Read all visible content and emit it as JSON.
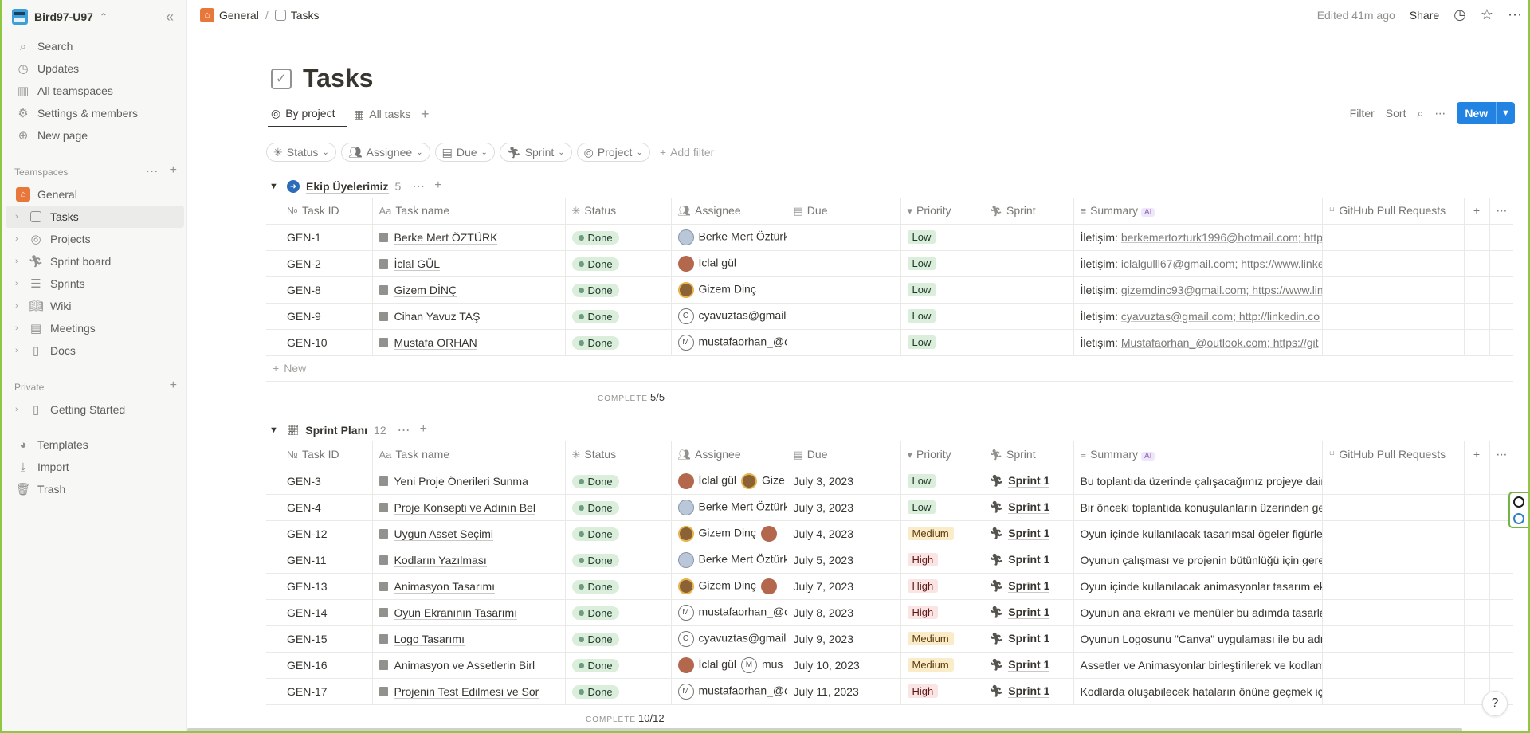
{
  "workspace": {
    "name": "Bird97-U97"
  },
  "sidebar": {
    "top_items": [
      {
        "label": "Search",
        "icon": "search-icon"
      },
      {
        "label": "Updates",
        "icon": "clock-icon"
      },
      {
        "label": "All teamspaces",
        "icon": "building-icon"
      },
      {
        "label": "Settings & members",
        "icon": "gear-icon"
      },
      {
        "label": "New page",
        "icon": "plus-circle-icon"
      }
    ],
    "teamspaces_label": "Teamspaces",
    "teamspace_items": [
      {
        "label": "General",
        "icon": "home-icon"
      },
      {
        "label": "Tasks",
        "icon": "checkbox-icon"
      },
      {
        "label": "Projects",
        "icon": "target-icon"
      },
      {
        "label": "Sprint board",
        "icon": "runner-icon"
      },
      {
        "label": "Sprints",
        "icon": "stack-icon"
      },
      {
        "label": "Wiki",
        "icon": "book-icon"
      },
      {
        "label": "Meetings",
        "icon": "calendar-icon"
      },
      {
        "label": "Docs",
        "icon": "document-icon"
      }
    ],
    "private_label": "Private",
    "private_items": [
      {
        "label": "Getting Started",
        "icon": "document-icon"
      }
    ],
    "bottom_items": [
      {
        "label": "Templates",
        "icon": "shapes-icon"
      },
      {
        "label": "Import",
        "icon": "download-icon"
      },
      {
        "label": "Trash",
        "icon": "trash-icon"
      }
    ]
  },
  "topbar": {
    "breadcrumb": [
      "General",
      "Tasks"
    ],
    "edited": "Edited 41m ago",
    "share": "Share"
  },
  "page": {
    "title": "Tasks",
    "views": [
      {
        "label": "By project"
      },
      {
        "label": "All tasks"
      }
    ],
    "tools": {
      "filter": "Filter",
      "sort": "Sort",
      "new": "New"
    },
    "filters": [
      "Status",
      "Assignee",
      "Due",
      "Sprint",
      "Project"
    ],
    "add_filter": "Add filter"
  },
  "columns": [
    "Task ID",
    "Task name",
    "Status",
    "Assignee",
    "Due",
    "Priority",
    "Sprint",
    "Summary",
    "GitHub Pull Requests"
  ],
  "ai_badge": "AI",
  "groups": [
    {
      "name": "Ekip Üyelerimiz",
      "count": "5",
      "complete_label": "COMPLETE",
      "complete": "5/5",
      "new_label": "New",
      "rows": [
        {
          "id": "GEN-1",
          "name": "Berke Mert ÖZTÜRK",
          "status": "Done",
          "assignee": "Berke Mert Öztürk",
          "avatar": "b",
          "due": "",
          "priority": "Low",
          "sprint": "",
          "summary_prefix": "İletişim: ",
          "summary": "berkemertozturk1996@hotmail.com; http"
        },
        {
          "id": "GEN-2",
          "name": "İclal GÜL",
          "status": "Done",
          "assignee": "İclal gül",
          "avatar": "i",
          "due": "",
          "priority": "Low",
          "sprint": "",
          "summary_prefix": "İletişim: ",
          "summary": "iclalgulll67@gmail.com; https://www.linke"
        },
        {
          "id": "GEN-8",
          "name": "Gizem DİNÇ",
          "status": "Done",
          "assignee": "Gizem Dinç",
          "avatar": "g",
          "due": "",
          "priority": "Low",
          "sprint": "",
          "summary_prefix": "İletişim: ",
          "summary": "gizemdinc93@gmail.com; https://www.lin"
        },
        {
          "id": "GEN-9",
          "name": "Cihan Yavuz TAŞ",
          "status": "Done",
          "assignee": "cyavuztas@gmail.",
          "avatar": "C",
          "due": "",
          "priority": "Low",
          "sprint": "",
          "summary_prefix": "İletişim: ",
          "summary": "cyavuztas@gmail.com; http://linkedin.co"
        },
        {
          "id": "GEN-10",
          "name": "Mustafa ORHAN",
          "status": "Done",
          "assignee": "mustafaorhan_@c",
          "avatar": "M",
          "due": "",
          "priority": "Low",
          "sprint": "",
          "summary_prefix": "İletişim: ",
          "summary": "Mustafaorhan_@outlook.com; https://git"
        }
      ]
    },
    {
      "name": "Sprint Planı",
      "count": "12",
      "complete_label": "COMPLETE",
      "complete": "10/12",
      "rows": [
        {
          "id": "GEN-3",
          "name": "Yeni Proje Önerileri Sunma",
          "status": "Done",
          "assignee": "İclal gül",
          "avatar": "i",
          "assignee2": "Gize",
          "avatar2": "g",
          "due": "July 3, 2023",
          "priority": "Low",
          "sprint": "Sprint 1",
          "summary_prefix": "",
          "summary": "Bu toplantıda üzerinde çalışacağımız projeye dair"
        },
        {
          "id": "GEN-4",
          "name": "Proje Konsepti ve Adının Bel",
          "status": "Done",
          "assignee": "Berke Mert Öztürk",
          "avatar": "b",
          "due": "July 3, 2023",
          "priority": "Low",
          "sprint": "Sprint 1",
          "summary_prefix": "",
          "summary": "Bir önceki toplantıda konuşulanların üzerinden ge"
        },
        {
          "id": "GEN-12",
          "name": "Uygun Asset Seçimi",
          "status": "Done",
          "assignee": "Gizem Dinç",
          "avatar": "g",
          "assignee2": "",
          "avatar2": "i",
          "due": "July 4, 2023",
          "priority": "Medium",
          "sprint": "Sprint 1",
          "summary_prefix": "",
          "summary": "Oyun içinde kullanılacak tasarımsal ögeler figürle"
        },
        {
          "id": "GEN-11",
          "name": "Kodların Yazılması",
          "status": "Done",
          "assignee": "Berke Mert Öztürk",
          "avatar": "b",
          "due": "July 5, 2023",
          "priority": "High",
          "sprint": "Sprint 1",
          "summary_prefix": "",
          "summary": "Oyunun çalışması ve projenin bütünlüğü için gere"
        },
        {
          "id": "GEN-13",
          "name": "Animasyon Tasarımı",
          "status": "Done",
          "assignee": "Gizem Dinç",
          "avatar": "g",
          "assignee2": "",
          "avatar2": "i",
          "due": "July 7, 2023",
          "priority": "High",
          "sprint": "Sprint 1",
          "summary_prefix": "",
          "summary": "Oyun içinde kullanılacak animasyonlar tasarım eki"
        },
        {
          "id": "GEN-14",
          "name": "Oyun Ekranının Tasarımı",
          "status": "Done",
          "assignee": "mustafaorhan_@c",
          "avatar": "M",
          "due": "July 8, 2023",
          "priority": "High",
          "sprint": "Sprint 1",
          "summary_prefix": "",
          "summary": "Oyunun ana ekranı ve menüler bu adımda tasarla"
        },
        {
          "id": "GEN-15",
          "name": "Logo Tasarımı",
          "status": "Done",
          "assignee": "cyavuztas@gmail.",
          "avatar": "C",
          "due": "July 9, 2023",
          "priority": "Medium",
          "sprint": "Sprint 1",
          "summary_prefix": "",
          "summary": "Oyunun Logosunu \"Canva\" uygulaması ile bu adır"
        },
        {
          "id": "GEN-16",
          "name": "Animasyon ve Assetlerin Birl",
          "status": "Done",
          "assignee": "İclal gül",
          "avatar": "i",
          "assignee2": "mus",
          "avatar2": "M",
          "due": "July 10, 2023",
          "priority": "Medium",
          "sprint": "Sprint 1",
          "summary_prefix": "",
          "summary": "Assetler ve Animasyonlar birleştirilerek ve kodlam"
        },
        {
          "id": "GEN-17",
          "name": "Projenin Test Edilmesi ve Sor",
          "status": "Done",
          "assignee": "mustafaorhan_@c",
          "avatar": "M",
          "due": "July 11, 2023",
          "priority": "High",
          "sprint": "Sprint 1",
          "summary_prefix": "",
          "summary": "Kodlarda oluşabilecek hataların önüne geçmek içi"
        }
      ]
    }
  ],
  "help": "?"
}
